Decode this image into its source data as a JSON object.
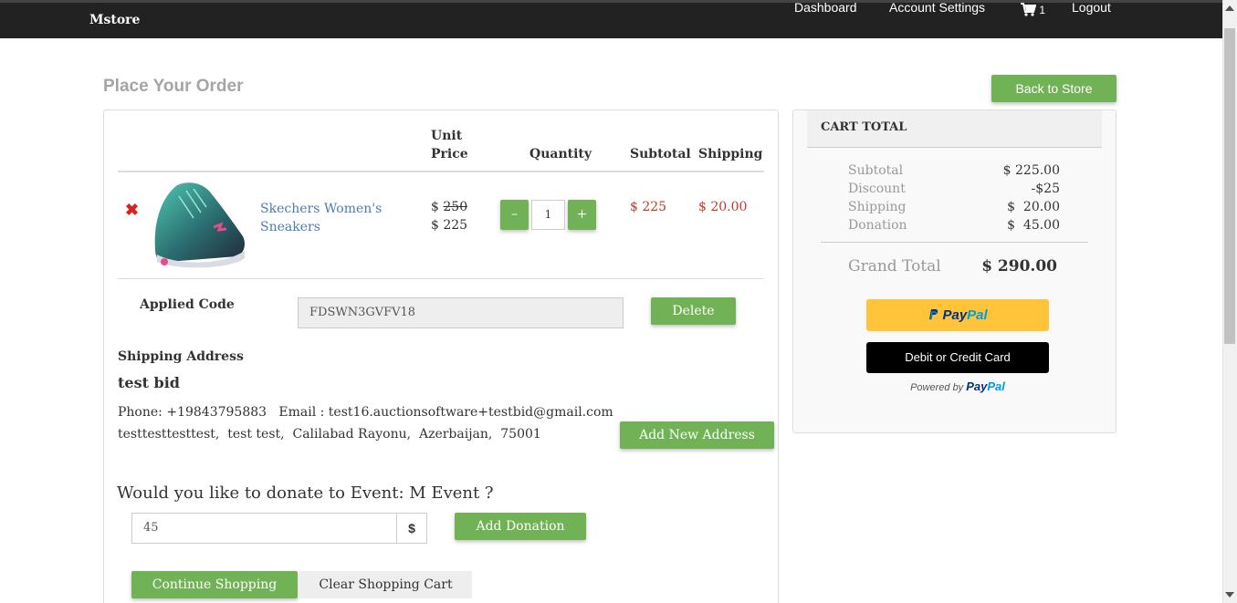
{
  "navbar": {
    "brand": "Mstore",
    "links": [
      "Dashboard",
      "Account Settings"
    ],
    "cart_count": "1",
    "logout": "Logout"
  },
  "page": {
    "title": "Place Your Order",
    "back_button": "Back to Store"
  },
  "table": {
    "headers": {
      "unit_price_line1": "Unit",
      "unit_price_line2": "Price",
      "quantity": "Quantity",
      "subtotal": "Subtotal",
      "shipping": "Shipping"
    },
    "items": [
      {
        "name": "Skechers Women's Sneakers",
        "price_old_symbol": "$",
        "price_old": "250",
        "price_new": "$ 225",
        "quantity": "1",
        "subtotal": "$ 225",
        "shipping": "$ 20.00"
      }
    ],
    "qty_minus": "–",
    "qty_plus": "+",
    "remove_icon": "✖"
  },
  "coupon": {
    "label": "Applied Code",
    "value": "FDSWN3GVFV18",
    "delete_button": "Delete"
  },
  "shipping_address": {
    "title": "Shipping Address",
    "name": "test bid",
    "line1": "Phone: +19843795883   Email : test16.auctionsoftware+testbid@gmail.com",
    "line2": "testtesttesttest,  test test,  Calilabad Rayonu,  Azerbaijan,  75001",
    "add_button": "Add New Address"
  },
  "donation": {
    "question": "Would you like to donate to Event: M Event ?",
    "amount": "45",
    "currency": "$",
    "add_button": "Add Donation"
  },
  "actions": {
    "continue": "Continue Shopping",
    "clear": "Clear Shopping Cart"
  },
  "cart_total": {
    "header": "CART TOTAL",
    "rows": [
      {
        "label": "Subtotal",
        "value": "$ 225.00"
      },
      {
        "label": "Discount",
        "value": "-$25"
      },
      {
        "label": "Shipping",
        "value": "$  20.00"
      },
      {
        "label": "Donation",
        "value": "$  45.00"
      }
    ],
    "grand_label": "Grand Total",
    "grand_value": "$ 290.00",
    "paypal_p1": "Pay",
    "paypal_p2": "Pal",
    "card_button": "Debit or Credit Card",
    "powered_by": "Powered by",
    "powered_p1": "Pay",
    "powered_p2": "Pal"
  },
  "colors": {
    "accent_green": "#71b256",
    "navbar_bg": "#222222",
    "price_red": "#c0392b",
    "paypal_yellow": "#ffc439"
  }
}
